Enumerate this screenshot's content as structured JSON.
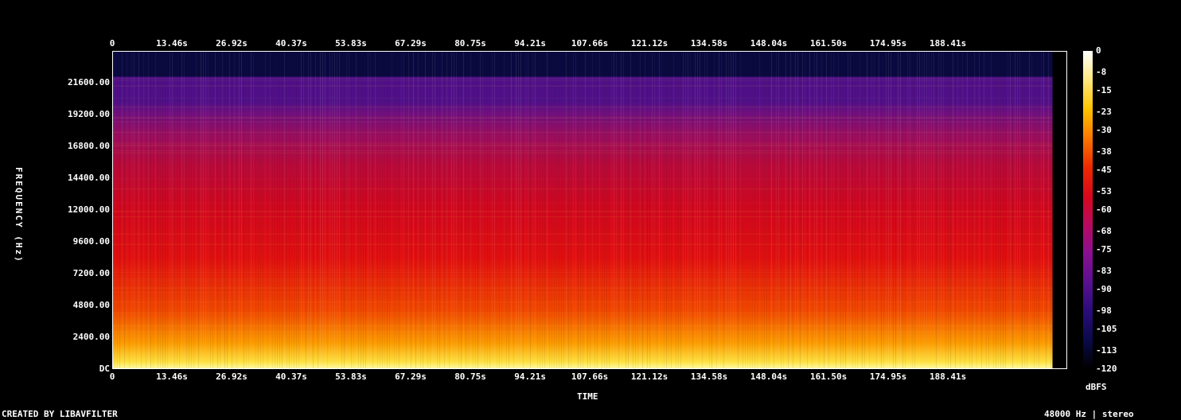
{
  "footer": {
    "left": "CREATED BY LIBAVFILTER",
    "right": "48000 Hz | stereo"
  },
  "chart_data": {
    "type": "heatmap",
    "title": "",
    "xlabel": "TIME",
    "ylabel": "FREQUENCY (Hz)",
    "x_ticks": [
      "0",
      "13.46s",
      "26.92s",
      "40.37s",
      "53.83s",
      "67.29s",
      "80.75s",
      "94.21s",
      "107.66s",
      "121.12s",
      "134.58s",
      "148.04s",
      "161.50s",
      "174.95s",
      "188.41s"
    ],
    "x_tick_seconds": [
      0,
      13.46,
      26.92,
      40.37,
      53.83,
      67.29,
      80.75,
      94.21,
      107.66,
      121.12,
      134.58,
      148.04,
      161.5,
      174.95,
      188.41
    ],
    "xlim": [
      0,
      215.3
    ],
    "y_ticks": [
      "DC",
      "2400.00",
      "4800.00",
      "7200.00",
      "9600.00",
      "12000.00",
      "14400.00",
      "16800.00",
      "19200.00",
      "21600.00"
    ],
    "y_tick_hz": [
      0,
      2400,
      4800,
      7200,
      9600,
      12000,
      14400,
      16800,
      19200,
      21600
    ],
    "ylim": [
      0,
      24000
    ],
    "content_end_seconds": 212,
    "lowpass_cutoff_hz": 22050,
    "colorbar": {
      "label": "dBFS",
      "ticks": [
        "0",
        "-8",
        "-15",
        "-23",
        "-30",
        "-38",
        "-45",
        "-53",
        "-60",
        "-68",
        "-75",
        "-83",
        "-90",
        "-98",
        "-105",
        "-113",
        "-120"
      ],
      "range": [
        -120,
        0
      ],
      "colors": [
        "#000000",
        "#0a0a4a",
        "#2a0c7a",
        "#5a1090",
        "#8a1090",
        "#b80a60",
        "#d8081a",
        "#ee2a00",
        "#fb7800",
        "#fdc400",
        "#ffe780",
        "#ffffff"
      ]
    }
  }
}
